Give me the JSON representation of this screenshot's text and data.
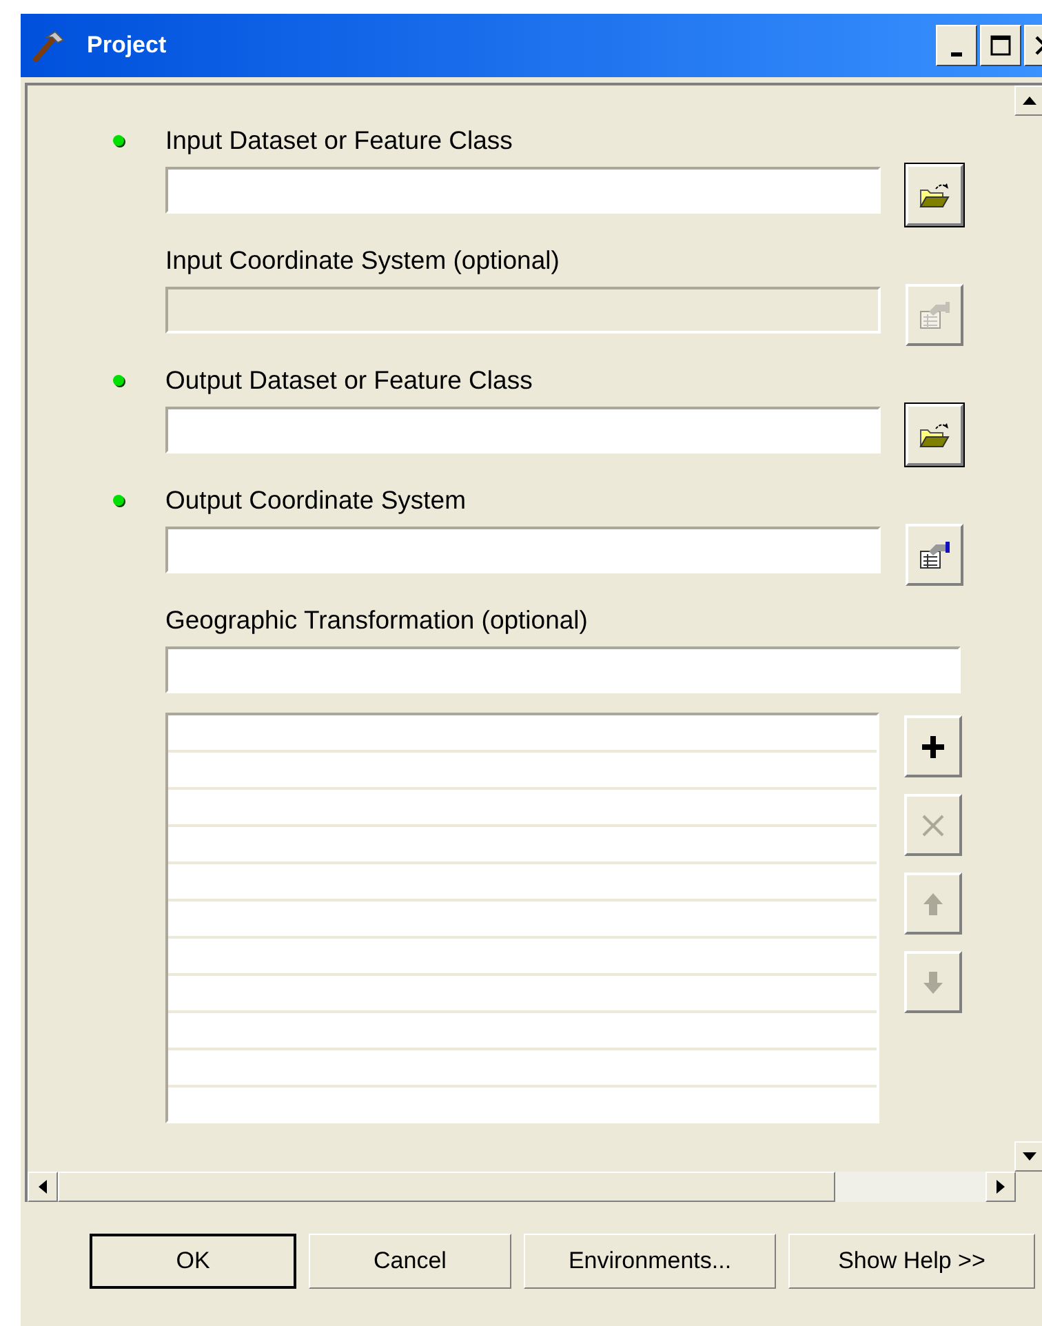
{
  "window": {
    "title": "Project"
  },
  "parameters": [
    {
      "label": "Input Dataset or Feature Class",
      "required": true,
      "disabled": false,
      "kind": "browse"
    },
    {
      "label": "Input Coordinate System (optional)",
      "required": false,
      "disabled": true,
      "kind": "properties"
    },
    {
      "label": "Output Dataset or Feature Class",
      "required": true,
      "disabled": false,
      "kind": "browse"
    },
    {
      "label": "Output Coordinate System",
      "required": true,
      "disabled": false,
      "kind": "properties"
    },
    {
      "label": "Geographic Transformation (optional)",
      "required": false,
      "disabled": false,
      "kind": "plain"
    }
  ],
  "list_buttons": [
    {
      "kind": "add",
      "disabled": false
    },
    {
      "kind": "remove",
      "disabled": true
    },
    {
      "kind": "up",
      "disabled": true
    },
    {
      "kind": "down",
      "disabled": true
    }
  ],
  "buttons": [
    {
      "label": "OK",
      "default": true
    },
    {
      "label": "Cancel",
      "default": false
    },
    {
      "label": "Environments...",
      "default": false
    },
    {
      "label": "Show Help >>",
      "default": false
    }
  ]
}
